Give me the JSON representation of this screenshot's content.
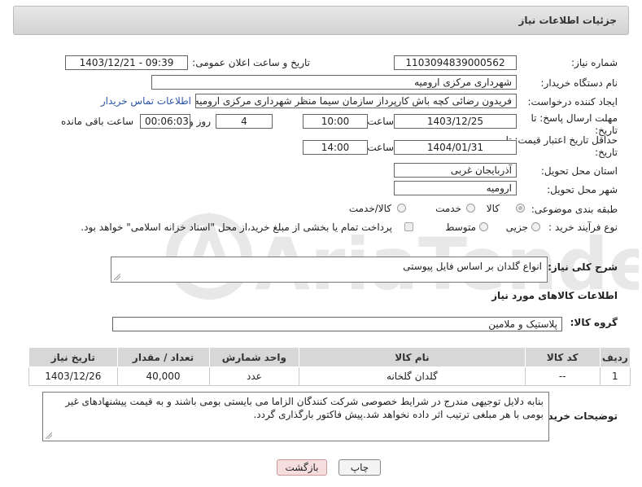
{
  "header": {
    "title": "جزئیات اطلاعات نیاز"
  },
  "form": {
    "need_number_label": "شماره نیاز:",
    "need_number": "1103094839000562",
    "announce_label": "تاریخ و ساعت اعلان عمومی:",
    "announce_value": "1403/12/21 - 09:39",
    "buyer_org_label": "نام دستگاه خریدار:",
    "buyer_org": "شهرداری مرکزی ارومیه",
    "requester_label": "ایجاد کننده درخواست:",
    "requester": "فریدون رضائی کچه باش کارپرداز سازمان سیما منظر شهرداری مرکزی ارومیه",
    "buyer_contact_link": "اطلاعات تماس خریدار",
    "deadline_label": "مهلت ارسال پاسخ: تا تاریخ:",
    "deadline_date": "1403/12/25",
    "time_label": "ساعت",
    "deadline_time": "10:00",
    "days_value": "4",
    "days_label": "روز و",
    "remaining_value": "00:06:03",
    "remaining_label": "ساعت باقی مانده",
    "validity_label": "حداقل تاریخ اعتبار قیمت: تا تاریخ:",
    "validity_date": "1404/01/31",
    "validity_time": "14:00",
    "province_label": "استان محل تحویل:",
    "province": "آذربایجان غربی",
    "city_label": "شهر محل تحویل:",
    "city": "ارومیه",
    "category_label": "طبقه بندی موضوعی:",
    "category_options": [
      "کالا",
      "خدمت",
      "کالا/خدمت"
    ],
    "process_label": "نوع فرآیند خرید :",
    "process_options": [
      "جزیی",
      "متوسط"
    ],
    "payment_note": "پرداخت تمام یا بخشی از مبلغ خرید،از محل \"اسناد خزانه اسلامی\" خواهد بود."
  },
  "description": {
    "label": "شرح کلی نیاز:",
    "value": "انواع گلدان بر اساس فایل پیوستی"
  },
  "goods_section": {
    "title": "اطلاعات کالاهای مورد نیاز",
    "group_label": "گروه کالا:",
    "group_value": "پلاستیک و ملامین"
  },
  "table": {
    "headers": [
      "ردیف",
      "کد کالا",
      "نام کالا",
      "واحد شمارش",
      "تعداد / مقدار",
      "تاریخ نیاز"
    ],
    "rows": [
      [
        "1",
        "--",
        "گلدان گلخانه",
        "عدد",
        "40,000",
        "1403/12/26"
      ]
    ]
  },
  "buyer_notes": {
    "label": "توضیحات خریدار:",
    "value": "بنابه دلایل توجیهی مندرج در شرایط خصوصی شرکت کنندگان الزاما می بایستی بومی باشند و به قیمت پیشنهادهای غیر بومی با هر مبلغی ترتیب اثر داده نخواهد شد.پیش فاکتور بارگذاری گردد."
  },
  "buttons": {
    "print": "چاپ",
    "back": "بازگشت"
  },
  "watermark_text": "AriaTender.net",
  "colors": {
    "link": "#2a55a5",
    "back_button_bg": "#f6dede",
    "header_bg": "#d9d9d9"
  }
}
